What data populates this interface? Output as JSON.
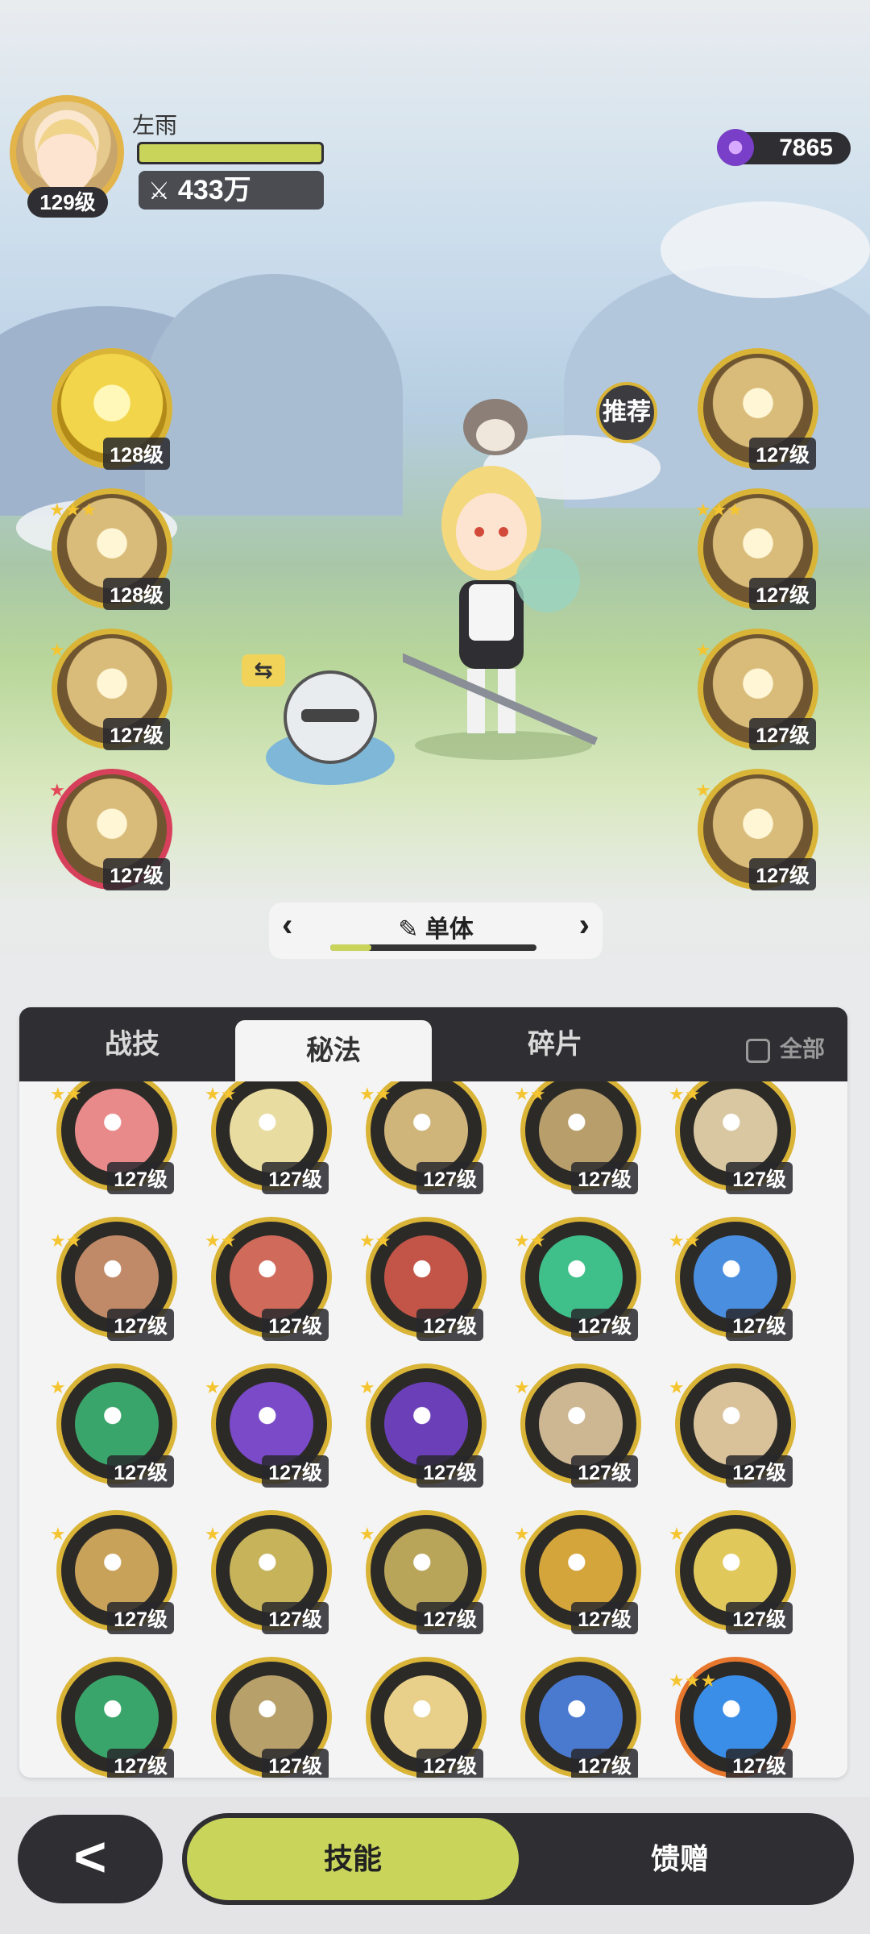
{
  "player": {
    "name": "左雨",
    "level": "129级",
    "power": "433万",
    "hp_fraction": 1.0
  },
  "currency": {
    "amount": "7865"
  },
  "recommend_label": "推荐",
  "left_skills": [
    {
      "level": "128级",
      "stars": "",
      "style": "gold"
    },
    {
      "level": "128级",
      "stars": "★★★",
      "style": "normal"
    },
    {
      "level": "127级",
      "stars": "★",
      "style": "normal"
    },
    {
      "level": "127级",
      "stars": "★",
      "style": "red"
    }
  ],
  "right_skills": [
    {
      "level": "127级",
      "stars": ""
    },
    {
      "level": "127级",
      "stars": "★★★"
    },
    {
      "level": "127级",
      "stars": "★"
    },
    {
      "level": "127级",
      "stars": "★"
    }
  ],
  "mode": {
    "label": "单体",
    "progress": 0.2
  },
  "tabs": [
    "战技",
    "秘法",
    "碎片"
  ],
  "active_tab": 1,
  "check_all_label": "全部",
  "grid": [
    {
      "level": "127级",
      "stars": "★★",
      "color": "#e98a8a"
    },
    {
      "level": "127级",
      "stars": "★★",
      "color": "#e9dca0"
    },
    {
      "level": "127级",
      "stars": "★★",
      "color": "#cfb57a"
    },
    {
      "level": "127级",
      "stars": "★★",
      "color": "#b89e6a"
    },
    {
      "level": "127级",
      "stars": "★★",
      "color": "#d8c7a0"
    },
    {
      "level": "127级",
      "stars": "★★",
      "color": "#c08a68"
    },
    {
      "level": "127级",
      "stars": "★★",
      "color": "#d06a5a"
    },
    {
      "level": "127级",
      "stars": "★★",
      "color": "#c25548"
    },
    {
      "level": "127级",
      "stars": "★★",
      "color": "#3fbf8a"
    },
    {
      "level": "127级",
      "stars": "★★",
      "color": "#4a8ee0"
    },
    {
      "level": "127级",
      "stars": "★",
      "color": "#3aa56a"
    },
    {
      "level": "127级",
      "stars": "★",
      "color": "#7a4ac8"
    },
    {
      "level": "127级",
      "stars": "★",
      "color": "#6a3fb8"
    },
    {
      "level": "127级",
      "stars": "★",
      "color": "#cdb692"
    },
    {
      "level": "127级",
      "stars": "★",
      "color": "#d9c29a"
    },
    {
      "level": "127级",
      "stars": "★",
      "color": "#c9a25a"
    },
    {
      "level": "127级",
      "stars": "★",
      "color": "#c7b35a"
    },
    {
      "level": "127级",
      "stars": "★",
      "color": "#b8a55a"
    },
    {
      "level": "127级",
      "stars": "★",
      "color": "#d4a53a"
    },
    {
      "level": "127级",
      "stars": "★",
      "color": "#e0c85a"
    },
    {
      "level": "127级",
      "stars": "",
      "color": "#3aa56a"
    },
    {
      "level": "127级",
      "stars": "",
      "color": "#b8a06a"
    },
    {
      "level": "127级",
      "stars": "",
      "color": "#e8d08a"
    },
    {
      "level": "127级",
      "stars": "",
      "color": "#4a7ad0"
    },
    {
      "level": "127级",
      "stars": "★★★",
      "color": "#3a8ee8",
      "border": "orange"
    }
  ],
  "bottom": {
    "back_icon": "<",
    "skill_label": "技能",
    "gift_label": "馈赠"
  }
}
